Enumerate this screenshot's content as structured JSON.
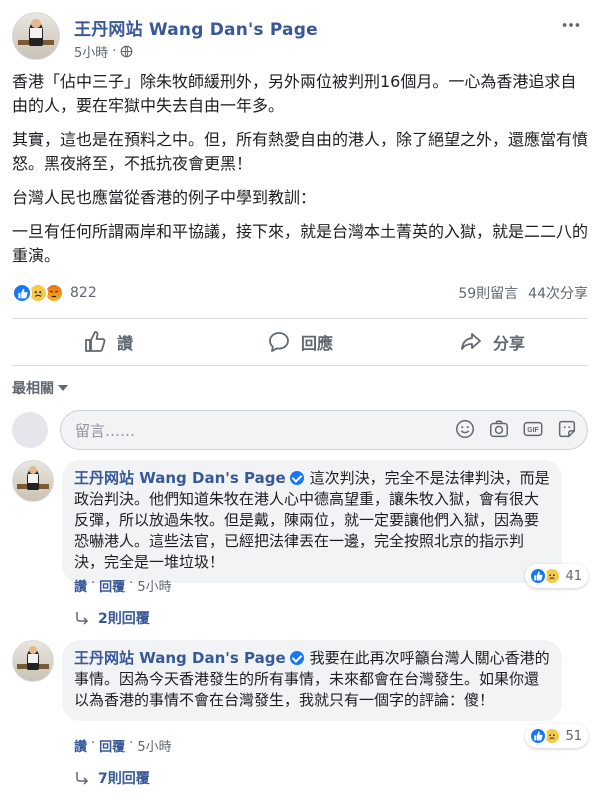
{
  "post": {
    "page_name": "王丹网站 Wang Dan's Page",
    "time": "5小時",
    "dot": "·",
    "paragraphs": [
      "香港「佔中三子」除朱牧師緩刑外，另外兩位被判刑16個月。一心為香港追求自由的人，要在牢獄中失去自由一年多。",
      "其實，這也是在預料之中。但，所有熱愛自由的港人，除了絕望之外，還應當有憤怒。黑夜將至，不抵抗夜會更黑！",
      "台灣人民也應當從香港的例子中學到教訓：",
      "一旦有任何所謂兩岸和平協議，接下來，就是台灣本土菁英的入獄，就是二二八的重演。"
    ]
  },
  "reactions": {
    "count": "822",
    "comments": "59則留言",
    "shares": "44次分享"
  },
  "actions": {
    "like": "讚",
    "comment": "回應",
    "share": "分享"
  },
  "sort": {
    "label": "最相關"
  },
  "composer": {
    "placeholder": "留言……"
  },
  "comments": [
    {
      "author": "王丹网站 Wang Dan's Page",
      "text": "這次判決，完全不是法律判決，而是政治判決。他們知道朱牧在港人心中德高望重，讓朱牧入獄，會有很大反彈，所以放過朱牧。但是戴，陳兩位，就一定要讓他們入獄，因為要恐嚇港人。這些法官，已經把法律丟在一邊，完全按照北京的指示判決，完全是一堆垃圾！",
      "reaction_count": "41",
      "like": "讚",
      "reply": "回覆",
      "time": "5小時",
      "replies": "2則回覆"
    },
    {
      "author": "王丹网站 Wang Dan's Page",
      "text": "我要在此再次呼籲台灣人關心香港的事情。因為今天香港發生的所有事情，未來都會在台灣發生。如果你還以為香港的事情不會在台灣發生，我就只有一個字的評論：傻！",
      "reaction_count": "51",
      "like": "讚",
      "reply": "回覆",
      "time": "5小時",
      "replies": "7則回覆"
    }
  ],
  "colors": {
    "link": "#385898",
    "like_blue": "#1877f2",
    "muted": "#606770"
  }
}
